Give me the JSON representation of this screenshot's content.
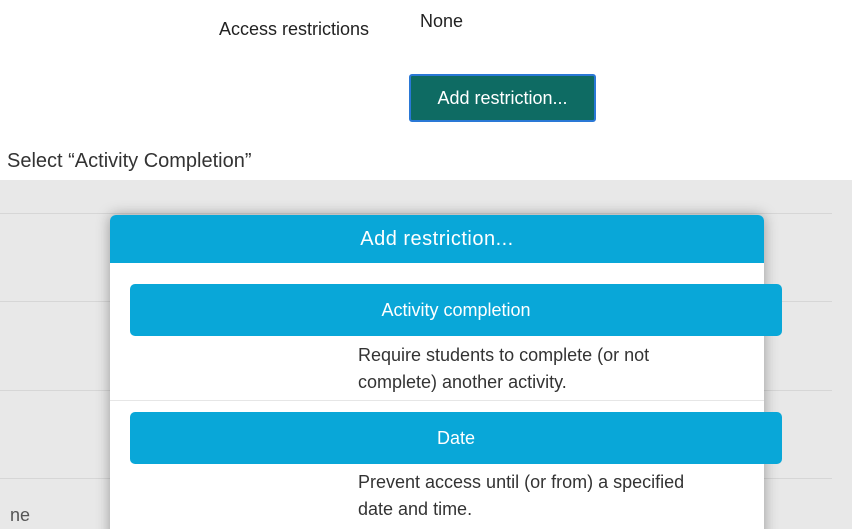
{
  "access": {
    "label": "Access restrictions",
    "value": "None",
    "add_button": "Add restriction..."
  },
  "caption": "Select “Activity Completion”",
  "screenshot": {
    "background_partial_text": "ne",
    "dialog": {
      "title": "Add restriction...",
      "options": [
        {
          "label": "Activity completion",
          "description_lines": [
            "Require students to complete (or not",
            "complete) another activity."
          ]
        },
        {
          "label": "Date",
          "description_lines": [
            "Prevent access until (or from) a specified",
            "date and time."
          ]
        }
      ]
    }
  },
  "colors": {
    "add_button_bg": "#0e6b63",
    "dialog_accent": "#09a7d8",
    "screenshot_bg": "#e8e8e8"
  }
}
